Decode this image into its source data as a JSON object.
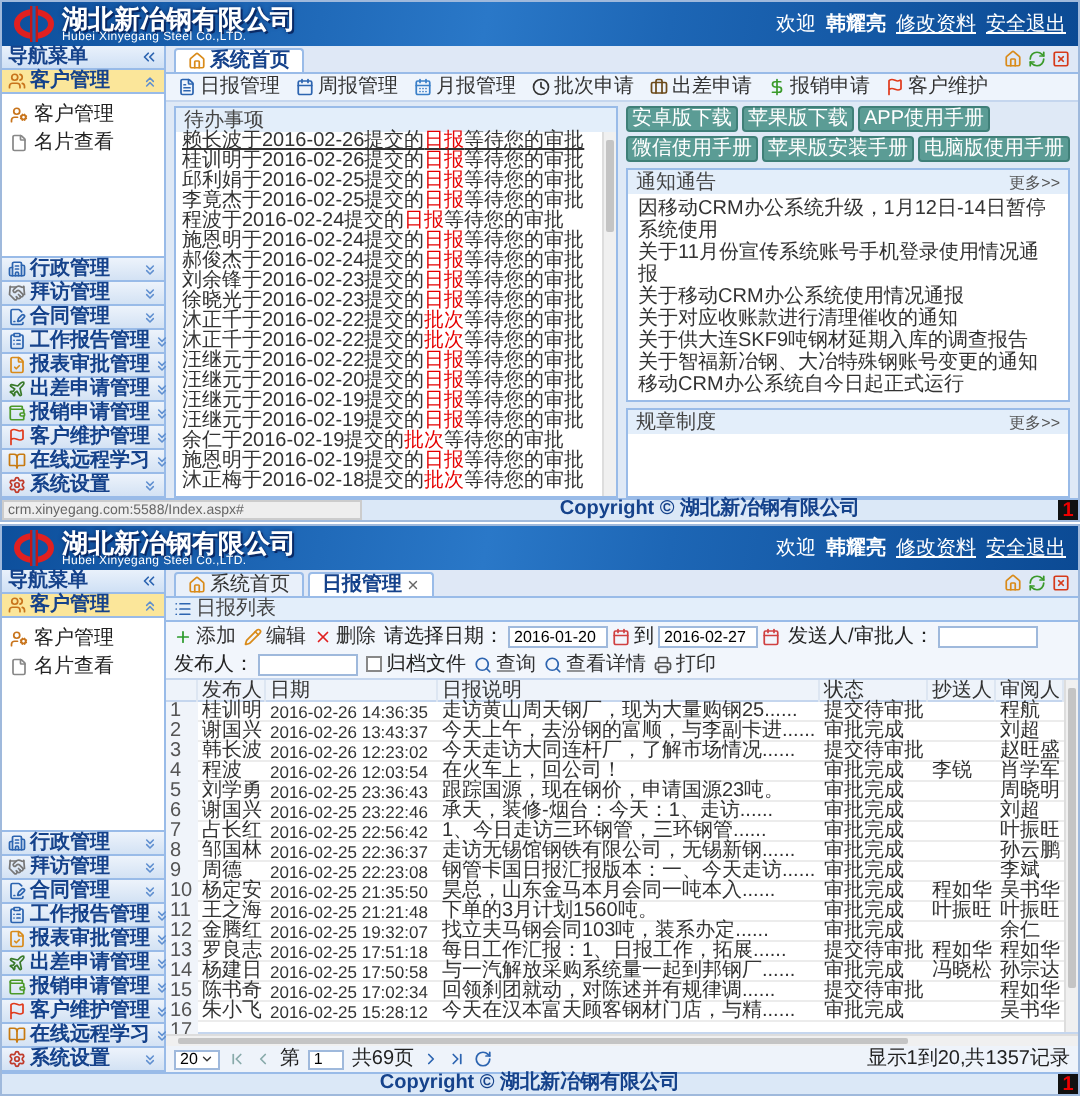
{
  "home_screen": {
    "header": {
      "company": "湖北新冶钢有限公司",
      "company_en": "Hubei Xinyegang Steel Co.,LTD.",
      "welcome": "欢迎",
      "user": "韩耀亮",
      "links": [
        "修改资料",
        "安全退出"
      ]
    },
    "sidebar": {
      "title": "导航菜单",
      "groups": [
        {
          "label": "客户管理",
          "expanded": true,
          "children": [
            "客户管理",
            "名片查看"
          ]
        },
        {
          "label": "行政管理",
          "expanded": false
        },
        {
          "label": "拜访管理",
          "expanded": false
        },
        {
          "label": "合同管理",
          "expanded": false
        },
        {
          "label": "工作报告管理",
          "expanded": false
        },
        {
          "label": "报表审批管理",
          "expanded": false
        },
        {
          "label": "出差申请管理",
          "expanded": false
        },
        {
          "label": "报销申请管理",
          "expanded": false
        },
        {
          "label": "客户维护管理",
          "expanded": false
        },
        {
          "label": "在线远程学习",
          "expanded": false
        },
        {
          "label": "系统设置",
          "expanded": false
        }
      ]
    },
    "tabs": [
      {
        "label": "系统首页",
        "selected": true,
        "closable": false
      }
    ],
    "toolbar": [
      "日报管理",
      "周报管理",
      "月报管理",
      "批次申请",
      "出差申请",
      "报销申请",
      "客户维护"
    ],
    "todo": {
      "title": "待办事项",
      "items": [
        {
          "prefix": "赖长波于2016-02-26提交的",
          "report_type": "日报",
          "suffix": "等待您的审批",
          "underlined": true
        },
        {
          "prefix": "桂训明于2016-02-26提交的",
          "report_type": "日报",
          "suffix": "等待您的审批",
          "underlined": false
        },
        {
          "prefix": "邱利娟于2016-02-25提交的",
          "report_type": "日报",
          "suffix": "等待您的审批",
          "underlined": false
        },
        {
          "prefix": "李竟杰于2016-02-25提交的",
          "report_type": "日报",
          "suffix": "等待您的审批",
          "underlined": false
        },
        {
          "prefix": "程波于2016-02-24提交的",
          "report_type": "日报",
          "suffix": "等待您的审批",
          "underlined": false
        },
        {
          "prefix": "施恩明于2016-02-24提交的",
          "report_type": "日报",
          "suffix": "等待您的审批",
          "underlined": false
        },
        {
          "prefix": "郝俊杰于2016-02-24提交的",
          "report_type": "日报",
          "suffix": "等待您的审批",
          "underlined": false
        },
        {
          "prefix": "刘余锋于2016-02-23提交的",
          "report_type": "日报",
          "suffix": "等待您的审批",
          "underlined": false
        },
        {
          "prefix": "徐晓光于2016-02-23提交的",
          "report_type": "日报",
          "suffix": "等待您的审批",
          "underlined": false
        },
        {
          "prefix": "沐正千于2016-02-22提交的",
          "report_type": "批次",
          "suffix": "等待您的审批",
          "underlined": false
        },
        {
          "prefix": "沐正千于2016-02-22提交的",
          "report_type": "批次",
          "suffix": "等待您的审批",
          "underlined": false
        },
        {
          "prefix": "汪继元于2016-02-22提交的",
          "report_type": "日报",
          "suffix": "等待您的审批",
          "underlined": false
        },
        {
          "prefix": "汪继元于2016-02-20提交的",
          "report_type": "日报",
          "suffix": "等待您的审批",
          "underlined": false
        },
        {
          "prefix": "汪继元于2016-02-19提交的",
          "report_type": "日报",
          "suffix": "等待您的审批",
          "underlined": false
        },
        {
          "prefix": "汪继元于2016-02-19提交的",
          "report_type": "日报",
          "suffix": "等待您的审批",
          "underlined": false
        },
        {
          "prefix": "余仁于2016-02-19提交的",
          "report_type": "批次",
          "suffix": "等待您的审批",
          "underlined": false
        },
        {
          "prefix": "施恩明于2016-02-19提交的",
          "report_type": "日报",
          "suffix": "等待您的审批",
          "underlined": false
        },
        {
          "prefix": "沐正梅于2016-02-18提交的",
          "report_type": "批次",
          "suffix": "等待您的审批",
          "underlined": false
        }
      ]
    },
    "downloads": [
      "安卓版下载",
      "苹果版下载",
      "APP使用手册",
      "微信使用手册",
      "苹果版安装手册",
      "电脑版使用手册"
    ],
    "notices": {
      "title": "通知通告",
      "more": "更多>>",
      "items": [
        "因移动CRM办公系统升级，1月12日-14日暂停系统使用",
        "关于11月份宣传系统账号手机登录使用情况通报",
        "关于移动CRM办公系统使用情况通报",
        "关于对应收账款进行清理催收的通知",
        "关于供大连SKF9吨钢材延期入库的调查报告",
        "关于智福新冶钢、大冶特殊钢账号变更的通知",
        "移动CRM办公系统自今日起正式运行"
      ]
    },
    "rules": {
      "title": "规章制度",
      "more": "更多>>"
    },
    "status_url": "crm.xinyegang.com:5588/Index.aspx#",
    "footer": {
      "copyright": "Copyright © 湖北新冶钢有限公司",
      "badge": "1"
    }
  },
  "log_screen": {
    "header": {
      "company": "湖北新冶钢有限公司",
      "company_en": "Hubei Xinyegang Steel Co.,LTD.",
      "welcome": "欢迎",
      "user": "韩耀亮",
      "links": [
        "修改资料",
        "安全退出"
      ]
    },
    "sidebar": {
      "title": "导航菜单",
      "groups": [
        {
          "label": "客户管理",
          "expanded": true,
          "children": [
            "客户管理",
            "名片查看"
          ]
        },
        {
          "label": "行政管理",
          "expanded": false
        },
        {
          "label": "拜访管理",
          "expanded": false
        },
        {
          "label": "合同管理",
          "expanded": false
        },
        {
          "label": "工作报告管理",
          "expanded": false
        },
        {
          "label": "报表审批管理",
          "expanded": false
        },
        {
          "label": "出差申请管理",
          "expanded": false
        },
        {
          "label": "报销申请管理",
          "expanded": false
        },
        {
          "label": "客户维护管理",
          "expanded": false
        },
        {
          "label": "在线远程学习",
          "expanded": false
        },
        {
          "label": "系统设置",
          "expanded": false
        }
      ]
    },
    "tabs": [
      {
        "label": "系统首页",
        "selected": false,
        "closable": false
      },
      {
        "label": "日报管理",
        "selected": true,
        "closable": true
      }
    ],
    "panel_title": "日报列表",
    "toolbar": {
      "actions": [
        "添加",
        "编辑",
        "删除"
      ],
      "date_label": "请选择日期：",
      "date_from": "2016-01-20",
      "date_to_label": "到",
      "date_to": "2016-02-27",
      "sender_label": "发送人/审批人：",
      "publisher_label": "发布人：",
      "archive": {
        "label": "归档文件",
        "checked": false
      },
      "buttons": [
        "查询",
        "查看详情",
        "打印"
      ]
    },
    "table": {
      "columns": [
        "发布人",
        "日期",
        "日报说明",
        "状态",
        "抄送人",
        "审阅人"
      ],
      "rows": [
        {
          "n": "1",
          "publisher": "桂训明",
          "date": "2016-02-26 14:36:35",
          "summary": "走访黄山周天钢厂，现为大量购钢25......",
          "status": "提交待审批",
          "reviewer": "程航"
        },
        {
          "n": "2",
          "publisher": "谢国兴",
          "date": "2016-02-26 13:43:37",
          "summary": "今天上午，去汾钢的富顺，与李副卡进......",
          "status": "审批完成",
          "reviewer": "刘超"
        },
        {
          "n": "3",
          "publisher": "韩长波",
          "date": "2016-02-26 12:23:02",
          "summary": "今天走访大同连杆厂，了解市场情况......",
          "status": "提交待审批",
          "reviewer": "赵旺盛"
        },
        {
          "n": "4",
          "publisher": "程波",
          "date": "2016-02-26 12:03:54",
          "summary": "在火车上，回公司！",
          "status": "审批完成",
          "cc": "李锐",
          "reviewer": "肖学军"
        },
        {
          "n": "5",
          "publisher": "刘学勇",
          "date": "2016-02-25 23:36:43",
          "summary": "跟踪国源，现在钢价，申请国源23吨。",
          "status": "审批完成",
          "reviewer": "周晓明"
        },
        {
          "n": "6",
          "publisher": "谢国兴",
          "date": "2016-02-25 23:22:46",
          "summary": "承天，装修-烟台：今天：1、走访......",
          "status": "审批完成",
          "reviewer": "刘超"
        },
        {
          "n": "7",
          "publisher": "占长红",
          "date": "2016-02-25 22:56:42",
          "summary": "1、今日走访三环钢管，三环钢管......",
          "status": "审批完成",
          "reviewer": "叶振旺"
        },
        {
          "n": "8",
          "publisher": "邹国林",
          "date": "2016-02-25 22:36:37",
          "summary": "走访无锡馆钢铁有限公司，无锡新钢......",
          "status": "审批完成",
          "reviewer": "孙云鹏"
        },
        {
          "n": "9",
          "publisher": "周德",
          "date": "2016-02-25 22:23:08",
          "summary": "钢管卡国日报汇报版本：一、今天走访......",
          "status": "审批完成",
          "reviewer": "李斌"
        },
        {
          "n": "10",
          "publisher": "杨定安",
          "date": "2016-02-25 21:35:50",
          "summary": "昊总，山东金马本月会同一吨本入......",
          "status": "审批完成",
          "cc": "程如华",
          "reviewer": "吴书华"
        },
        {
          "n": "11",
          "publisher": "王之海",
          "date": "2016-02-25 21:21:48",
          "summary": "下单的3月计划1560吨。",
          "status": "审批完成",
          "cc": "叶振旺",
          "reviewer": "叶振旺"
        },
        {
          "n": "12",
          "publisher": "金腾红",
          "date": "2016-02-25 19:32:07",
          "summary": "找立夫马钢会同103吨，装系办定......",
          "status": "审批完成",
          "reviewer": "余仁"
        },
        {
          "n": "13",
          "publisher": "罗良志",
          "date": "2016-02-25 17:51:18",
          "summary": "每日工作汇报：1、日报工作，拓展......",
          "status": "提交待审批",
          "cc": "程如华",
          "reviewer": "程如华"
        },
        {
          "n": "14",
          "publisher": "杨建日",
          "date": "2016-02-25 17:50:58",
          "summary": "与一汽解放采购系统量一起到邦钢厂......",
          "status": "审批完成",
          "cc": "冯晓松",
          "reviewer": "孙宗达"
        },
        {
          "n": "15",
          "publisher": "陈书奇",
          "date": "2016-02-25 17:02:34",
          "summary": "回领刹团就动，对陈述并有规律调......",
          "status": "提交待审批",
          "reviewer": "程如华"
        },
        {
          "n": "16",
          "publisher": "朱小飞",
          "date": "2016-02-25 15:28:12",
          "summary": "今天在汉本富天顾客钢材门店，与精......",
          "status": "审批完成",
          "reviewer": "吴书华"
        },
        {
          "n": "17"
        }
      ]
    },
    "pager": {
      "page_size": "20",
      "page_label": "第",
      "page": "1",
      "page_total": "共69页",
      "summary": "显示1到20,共1357记录"
    },
    "footer": {
      "copyright": "Copyright © 湖北新冶钢有限公司",
      "badge": "1"
    }
  }
}
